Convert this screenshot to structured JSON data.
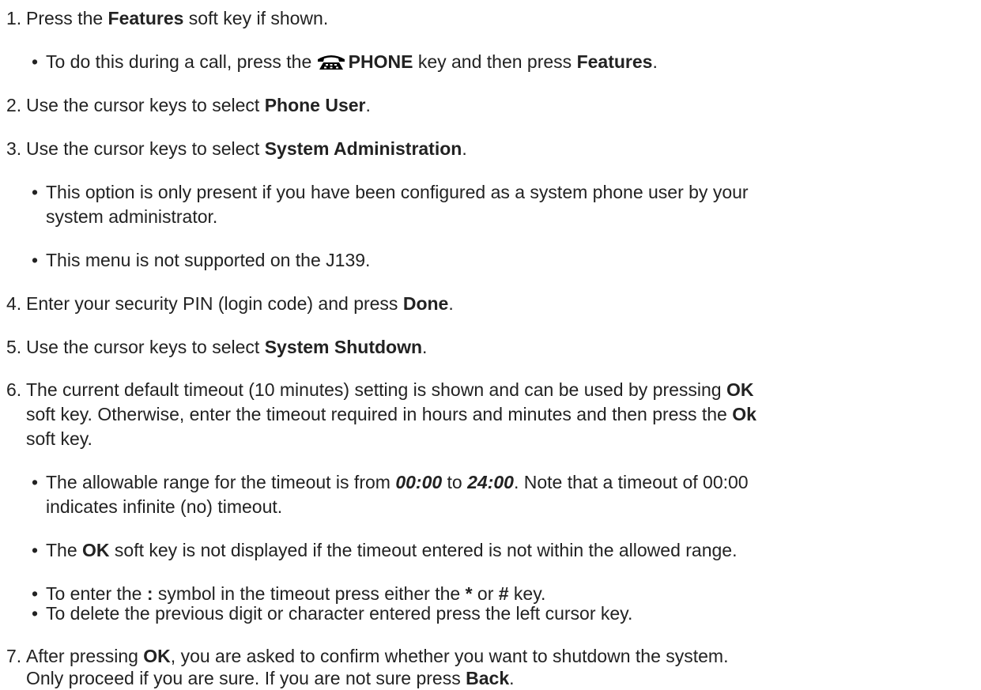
{
  "steps": [
    {
      "number": "1.",
      "parts": [
        "Press the ",
        "Features",
        " soft key if shown."
      ],
      "bullets": [
        {
          "parts": [
            "To do this during a call, press the ",
            "PHONE",
            " key and then press ",
            "Features",
            "."
          ],
          "icon": "phone-icon"
        }
      ]
    },
    {
      "number": "2.",
      "parts": [
        "Use the cursor keys to select ",
        "Phone User",
        "."
      ]
    },
    {
      "number": "3.",
      "parts": [
        "Use the cursor keys to select ",
        "System Administration",
        "."
      ],
      "bullets": [
        {
          "line1": "This option is only present if you have been configured as a system phone user by your",
          "line2": "system administrator."
        },
        {
          "text": "This menu is not supported on the J139."
        }
      ]
    },
    {
      "number": "4.",
      "parts": [
        "Enter your security PIN (login code) and press ",
        "Done",
        "."
      ]
    },
    {
      "number": "5.",
      "parts": [
        "Use the cursor keys to select ",
        "System Shutdown",
        "."
      ]
    },
    {
      "number": "6.",
      "line1_parts": [
        "The current default timeout (10 minutes) setting is shown and can be used by pressing ",
        "OK"
      ],
      "line2_parts": [
        "soft key. Otherwise, enter the timeout required in hours and minutes and then press the ",
        "Ok"
      ],
      "line3": "soft key.",
      "bullets": [
        {
          "line1_parts": [
            "The allowable range for the timeout is from ",
            "00:00",
            " to ",
            "24:00",
            ". Note that a timeout of 00:00"
          ],
          "line2": "indicates infinite (no) timeout."
        },
        {
          "parts": [
            "The ",
            "OK",
            " soft key is not displayed if the timeout entered is not within the allowed range."
          ]
        },
        {
          "parts": [
            "To enter the ",
            ":",
            " symbol in the timeout press either the ",
            "*",
            " or ",
            "#",
            " key."
          ]
        },
        {
          "text": "To delete the previous digit or character entered press the left cursor key."
        }
      ]
    },
    {
      "number": "7.",
      "line1_parts": [
        "After pressing ",
        "OK",
        ", you are asked to confirm whether you want to shutdown the system."
      ],
      "line2_parts": [
        "Only proceed if you are sure. If you are not sure press ",
        "Back",
        "."
      ]
    }
  ],
  "bullet_char": "•",
  "colors": {
    "text": "#222222",
    "background": "#ffffff"
  }
}
